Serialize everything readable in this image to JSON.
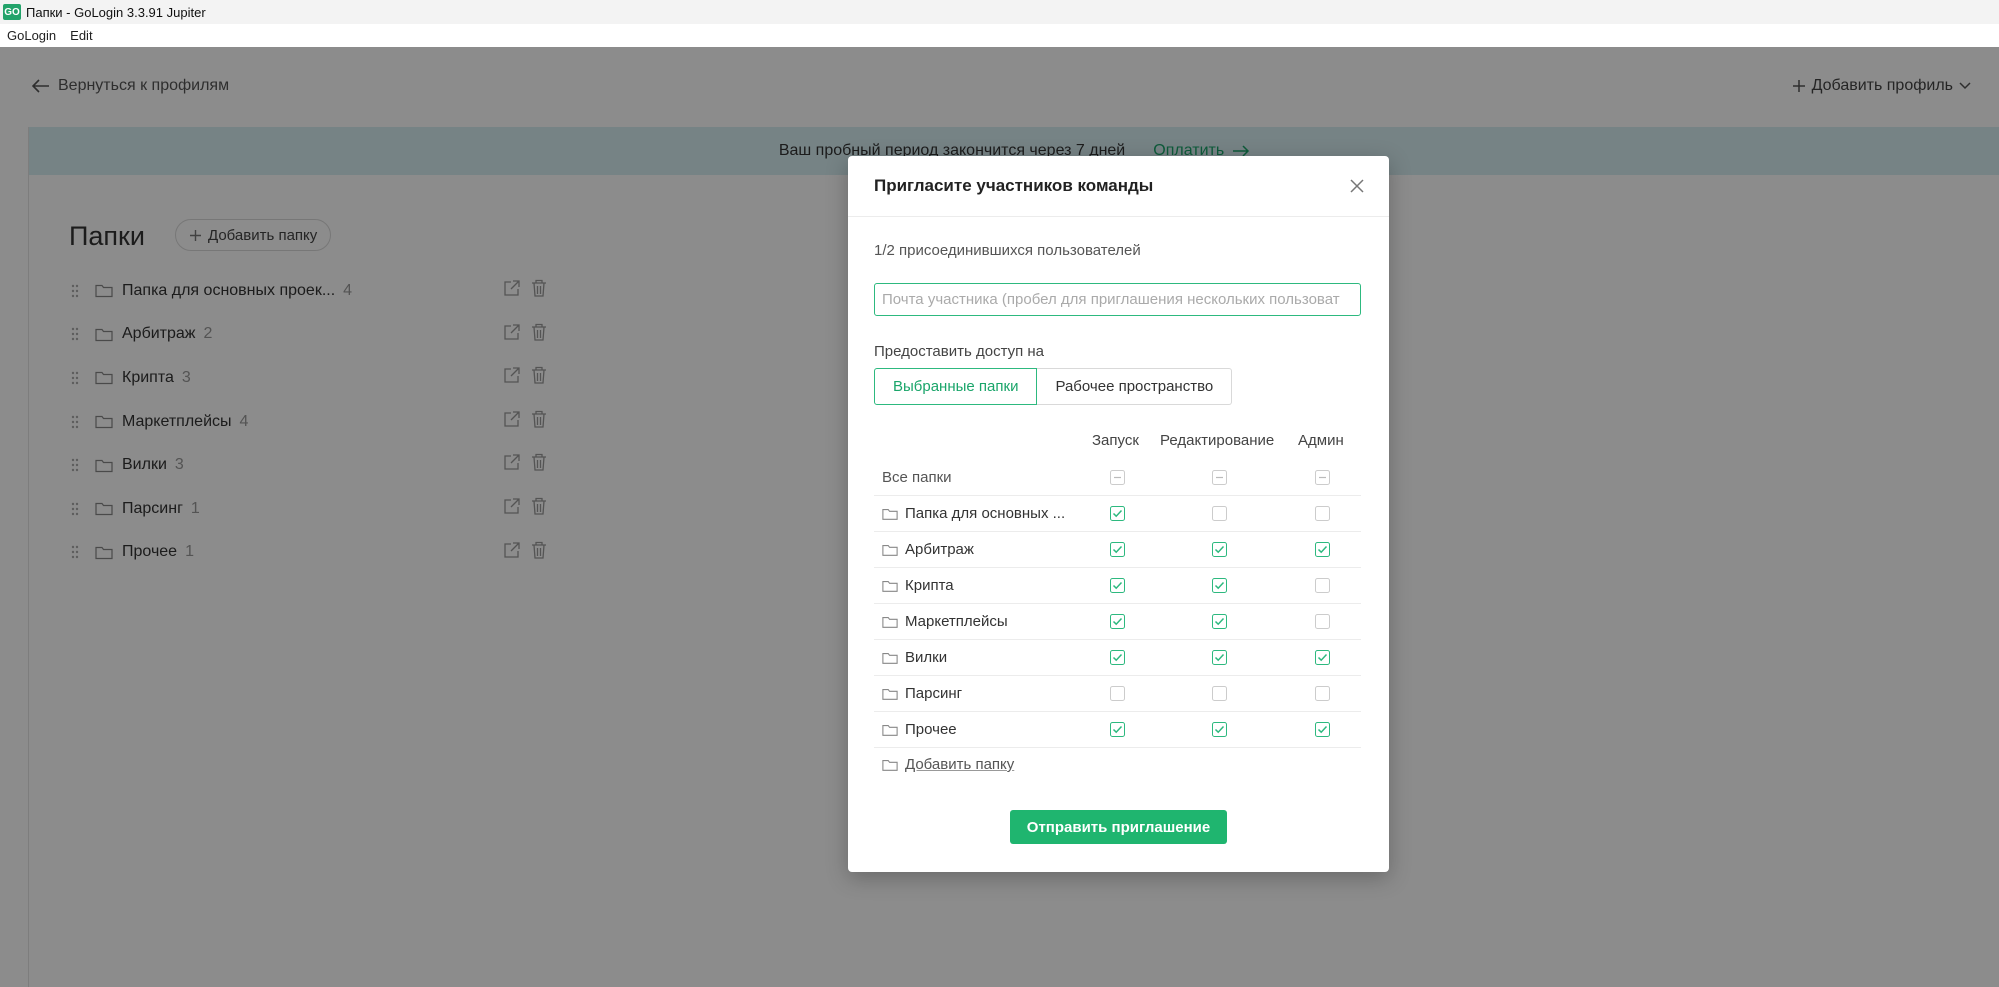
{
  "window": {
    "title": "Папки - GoLogin 3.3.91 Jupiter",
    "icon_text": "GO"
  },
  "menu": [
    "GoLogin",
    "Edit"
  ],
  "topnav": {
    "back_label": "Вернуться к профилям",
    "add_profile_label": "Добавить профиль"
  },
  "banner": {
    "text": "Ваш пробный период закончится через 7 дней",
    "pay_label": "Оплатить"
  },
  "folders_page": {
    "title": "Папки",
    "add_folder_label": "Добавить папку",
    "folders": [
      {
        "name": "Папка для основных проек...",
        "count": "4"
      },
      {
        "name": "Арбитраж",
        "count": "2"
      },
      {
        "name": "Крипта",
        "count": "3"
      },
      {
        "name": "Маркетплейсы",
        "count": "4"
      },
      {
        "name": "Вилки",
        "count": "3"
      },
      {
        "name": "Парсинг",
        "count": "1"
      },
      {
        "name": "Прочее",
        "count": "1"
      }
    ]
  },
  "modal": {
    "title": "Пригласите участников команды",
    "joined_text": "1/2 присоединившихся пользователей",
    "email_placeholder": "Почта участника (пробел для приглашения нескольких пользоват",
    "access_label": "Предоставить доступ на",
    "access_options": [
      "Выбранные папки",
      "Рабочее пространство"
    ],
    "access_selected": "Выбранные папки",
    "columns": [
      "Запуск",
      "Редактирование",
      "Админ"
    ],
    "all_folders_label": "Все папки",
    "rows": [
      {
        "name": "Папка для основных ...",
        "launch": true,
        "edit": false,
        "admin": false
      },
      {
        "name": "Арбитраж",
        "launch": true,
        "edit": true,
        "admin": true
      },
      {
        "name": "Крипта",
        "launch": true,
        "edit": true,
        "admin": false
      },
      {
        "name": "Маркетплейсы",
        "launch": true,
        "edit": true,
        "admin": false
      },
      {
        "name": "Вилки",
        "launch": true,
        "edit": true,
        "admin": true
      },
      {
        "name": "Парсинг",
        "launch": false,
        "edit": false,
        "admin": false
      },
      {
        "name": "Прочее",
        "launch": true,
        "edit": true,
        "admin": true
      }
    ],
    "add_folder_label": "Добавить папку",
    "send_label": "Отправить приглашение"
  },
  "colors": {
    "accent": "#1fb56f",
    "banner": "#d8eef3",
    "overlay": "rgba(0,0,0,0.45)"
  }
}
